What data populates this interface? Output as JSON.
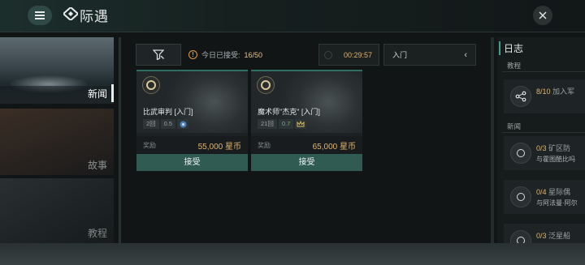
{
  "header": {
    "title": "际遇",
    "menu_icon": "hamburger-icon",
    "logo_icon": "diamond-logo-icon",
    "close_icon": "close-icon"
  },
  "sidebar": {
    "items": [
      {
        "label": "新闻",
        "selected": true
      },
      {
        "label": "故事",
        "selected": false
      },
      {
        "label": "教程",
        "selected": false
      }
    ]
  },
  "toolbar": {
    "filter_icon": "filter-icon",
    "accept_label": "今日已接受:",
    "accept_count": "16/50",
    "timer": "00:29:57",
    "level": "入门"
  },
  "cards": [
    {
      "name": "比武审判 [入门]",
      "tags": [
        "2回",
        "0.5"
      ],
      "reward_label": "奖励",
      "reward_value": "55,000 星币",
      "accept_label": "接受"
    },
    {
      "name": "魔术师\"杰克\" [入门]",
      "tags": [
        "21回",
        "0.7"
      ],
      "reward_label": "奖励",
      "reward_value": "65,000 星币",
      "accept_label": "接受"
    }
  ],
  "log": {
    "title": "日志",
    "sections": [
      {
        "label": "教程",
        "items": [
          {
            "progress": "8/10",
            "text": "加入军",
            "sub": ""
          }
        ]
      },
      {
        "label": "新闻",
        "items": [
          {
            "progress": "0/3",
            "text": "矿区防",
            "sub": "与霍图酷比吗"
          },
          {
            "progress": "0/4",
            "text": "星际偶",
            "sub": "与阿法曼·阿尔"
          },
          {
            "progress": "0/3",
            "text": "泛星船",
            "sub": ""
          }
        ]
      }
    ]
  },
  "colors": {
    "accent": "#2f5b52",
    "gold": "#e0b46c",
    "warning": "#e09a3c"
  }
}
